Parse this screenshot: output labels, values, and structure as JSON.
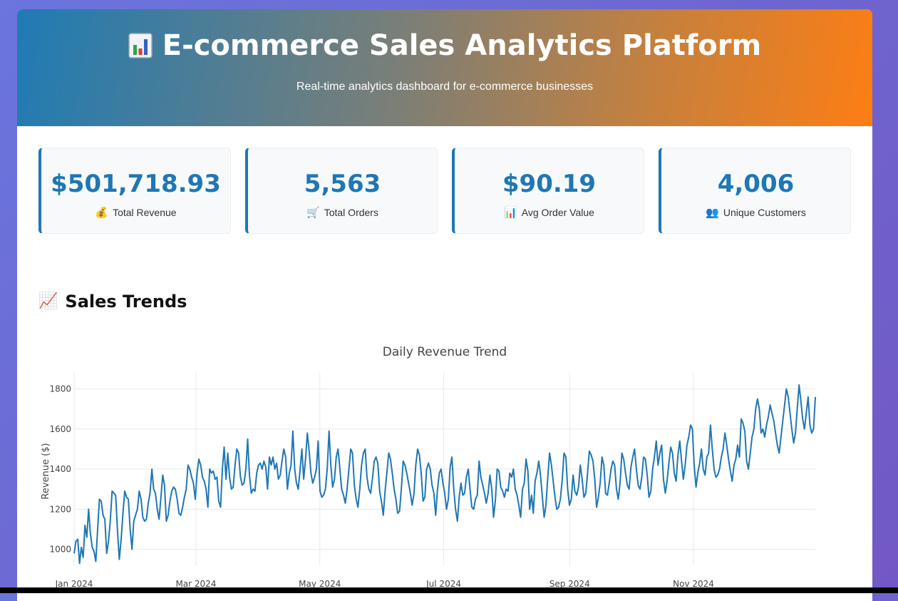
{
  "header": {
    "title": "E-commerce Sales Analytics Platform",
    "subtitle": "Real-time analytics dashboard for e-commerce businesses",
    "icon": "bar-chart-icon"
  },
  "metrics": [
    {
      "value": "$501,718.93",
      "label": "Total Revenue",
      "icon": "money-bag-icon",
      "emoji": "💰"
    },
    {
      "value": "5,563",
      "label": "Total Orders",
      "icon": "shopping-cart-icon",
      "emoji": "🛒"
    },
    {
      "value": "$90.19",
      "label": "Avg Order Value",
      "icon": "bar-chart-icon",
      "emoji": "📊"
    },
    {
      "value": "4,006",
      "label": "Unique Customers",
      "icon": "users-icon",
      "emoji": "👥"
    }
  ],
  "sales_section": {
    "title": "Sales Trends",
    "emoji": "📈",
    "icon": "chart-increasing-icon"
  },
  "colors": {
    "accent": "#1f77b4",
    "brand_orange": "#fd7e14",
    "line": "#1f77b4"
  },
  "chart_data": {
    "type": "line",
    "title": "Daily Revenue Trend",
    "xlabel": "",
    "ylabel": "Revenue ($)",
    "x_start": "2024-01-01",
    "x_end": "2024-12-31",
    "xticks": [
      "Jan 2024",
      "Mar 2024",
      "May 2024",
      "Jul 2024",
      "Sep 2024",
      "Nov 2024"
    ],
    "xtick_dates": [
      "2024-01-01",
      "2024-03-01",
      "2024-05-01",
      "2024-07-01",
      "2024-09-01",
      "2024-11-01"
    ],
    "yticks": [
      1000,
      1200,
      1400,
      1600,
      1800
    ],
    "ylim": [
      920,
      1880
    ],
    "grid": true,
    "series": [
      {
        "values": [
          980,
          1040,
          1050,
          930,
          1010,
          960,
          1120,
          1060,
          1200,
          1080,
          1010,
          990,
          940,
          1100,
          1250,
          1240,
          1170,
          1150,
          980,
          1040,
          1140,
          1290,
          1280,
          1270,
          1090,
          950,
          1050,
          1180,
          1290,
          1260,
          1250,
          1100,
          1000,
          1140,
          1170,
          1200,
          1290,
          1250,
          1160,
          1140,
          1150,
          1230,
          1280,
          1400,
          1300,
          1280,
          1200,
          1150,
          1260,
          1370,
          1320,
          1140,
          1170,
          1240,
          1290,
          1310,
          1300,
          1250,
          1180,
          1170,
          1210,
          1260,
          1300,
          1420,
          1400,
          1360,
          1330,
          1250,
          1380,
          1450,
          1420,
          1360,
          1340,
          1300,
          1210,
          1400,
          1380,
          1390,
          1350,
          1360,
          1240,
          1210,
          1400,
          1510,
          1350,
          1480,
          1360,
          1300,
          1310,
          1420,
          1500,
          1480,
          1360,
          1320,
          1330,
          1400,
          1550,
          1370,
          1280,
          1300,
          1290,
          1380,
          1420,
          1430,
          1400,
          1440,
          1410,
          1300,
          1460,
          1420,
          1460,
          1400,
          1430,
          1350,
          1370,
          1440,
          1500,
          1460,
          1300,
          1380,
          1420,
          1590,
          1400,
          1330,
          1300,
          1400,
          1500,
          1350,
          1450,
          1580,
          1490,
          1380,
          1330,
          1360,
          1400,
          1540,
          1290,
          1260,
          1270,
          1300,
          1400,
          1590,
          1420,
          1310,
          1350,
          1460,
          1500,
          1400,
          1300,
          1270,
          1230,
          1300,
          1400,
          1500,
          1480,
          1320,
          1250,
          1210,
          1300,
          1420,
          1480,
          1500,
          1360,
          1300,
          1280,
          1350,
          1440,
          1460,
          1430,
          1290,
          1240,
          1170,
          1290,
          1380,
          1480,
          1450,
          1380,
          1300,
          1250,
          1180,
          1190,
          1300,
          1440,
          1420,
          1380,
          1330,
          1280,
          1220,
          1280,
          1420,
          1500,
          1470,
          1380,
          1240,
          1260,
          1400,
          1430,
          1400,
          1320,
          1280,
          1170,
          1300,
          1380,
          1400,
          1330,
          1280,
          1200,
          1250,
          1410,
          1460,
          1300,
          1200,
          1140,
          1260,
          1330,
          1270,
          1280,
          1360,
          1400,
          1300,
          1210,
          1200,
          1250,
          1270,
          1440,
          1360,
          1320,
          1280,
          1230,
          1280,
          1370,
          1300,
          1160,
          1240,
          1400,
          1390,
          1310,
          1290,
          1260,
          1300,
          1290,
          1380,
          1360,
          1400,
          1300,
          1270,
          1220,
          1160,
          1300,
          1330,
          1450,
          1390,
          1200,
          1270,
          1180,
          1340,
          1380,
          1440,
          1370,
          1260,
          1160,
          1220,
          1360,
          1480,
          1420,
          1340,
          1260,
          1200,
          1210,
          1250,
          1350,
          1480,
          1460,
          1300,
          1220,
          1250,
          1370,
          1290,
          1270,
          1310,
          1420,
          1350,
          1260,
          1280,
          1380,
          1490,
          1470,
          1440,
          1350,
          1210,
          1260,
          1330,
          1460,
          1420,
          1280,
          1270,
          1330,
          1400,
          1440,
          1420,
          1300,
          1250,
          1330,
          1480,
          1450,
          1380,
          1320,
          1300,
          1410,
          1460,
          1500,
          1400,
          1320,
          1300,
          1360,
          1460,
          1450,
          1370,
          1260,
          1290,
          1400,
          1460,
          1540,
          1420,
          1480,
          1520,
          1350,
          1280,
          1340,
          1430,
          1510,
          1480,
          1380,
          1340,
          1470,
          1540,
          1440,
          1350,
          1420,
          1520,
          1560,
          1620,
          1600,
          1420,
          1310,
          1380,
          1430,
          1500,
          1400,
          1370,
          1460,
          1480,
          1620,
          1500,
          1400,
          1360,
          1370,
          1400,
          1460,
          1500,
          1580,
          1520,
          1450,
          1390,
          1340,
          1420,
          1450,
          1520,
          1460,
          1650,
          1630,
          1590,
          1440,
          1400,
          1480,
          1560,
          1600,
          1700,
          1750,
          1700,
          1580,
          1600,
          1560,
          1620,
          1660,
          1720,
          1680,
          1640,
          1580,
          1520,
          1480,
          1560,
          1640,
          1720,
          1800,
          1760,
          1680,
          1600,
          1530,
          1580,
          1700,
          1820,
          1740,
          1650,
          1600,
          1680,
          1760,
          1620,
          1580,
          1600,
          1760
        ]
      }
    ]
  }
}
